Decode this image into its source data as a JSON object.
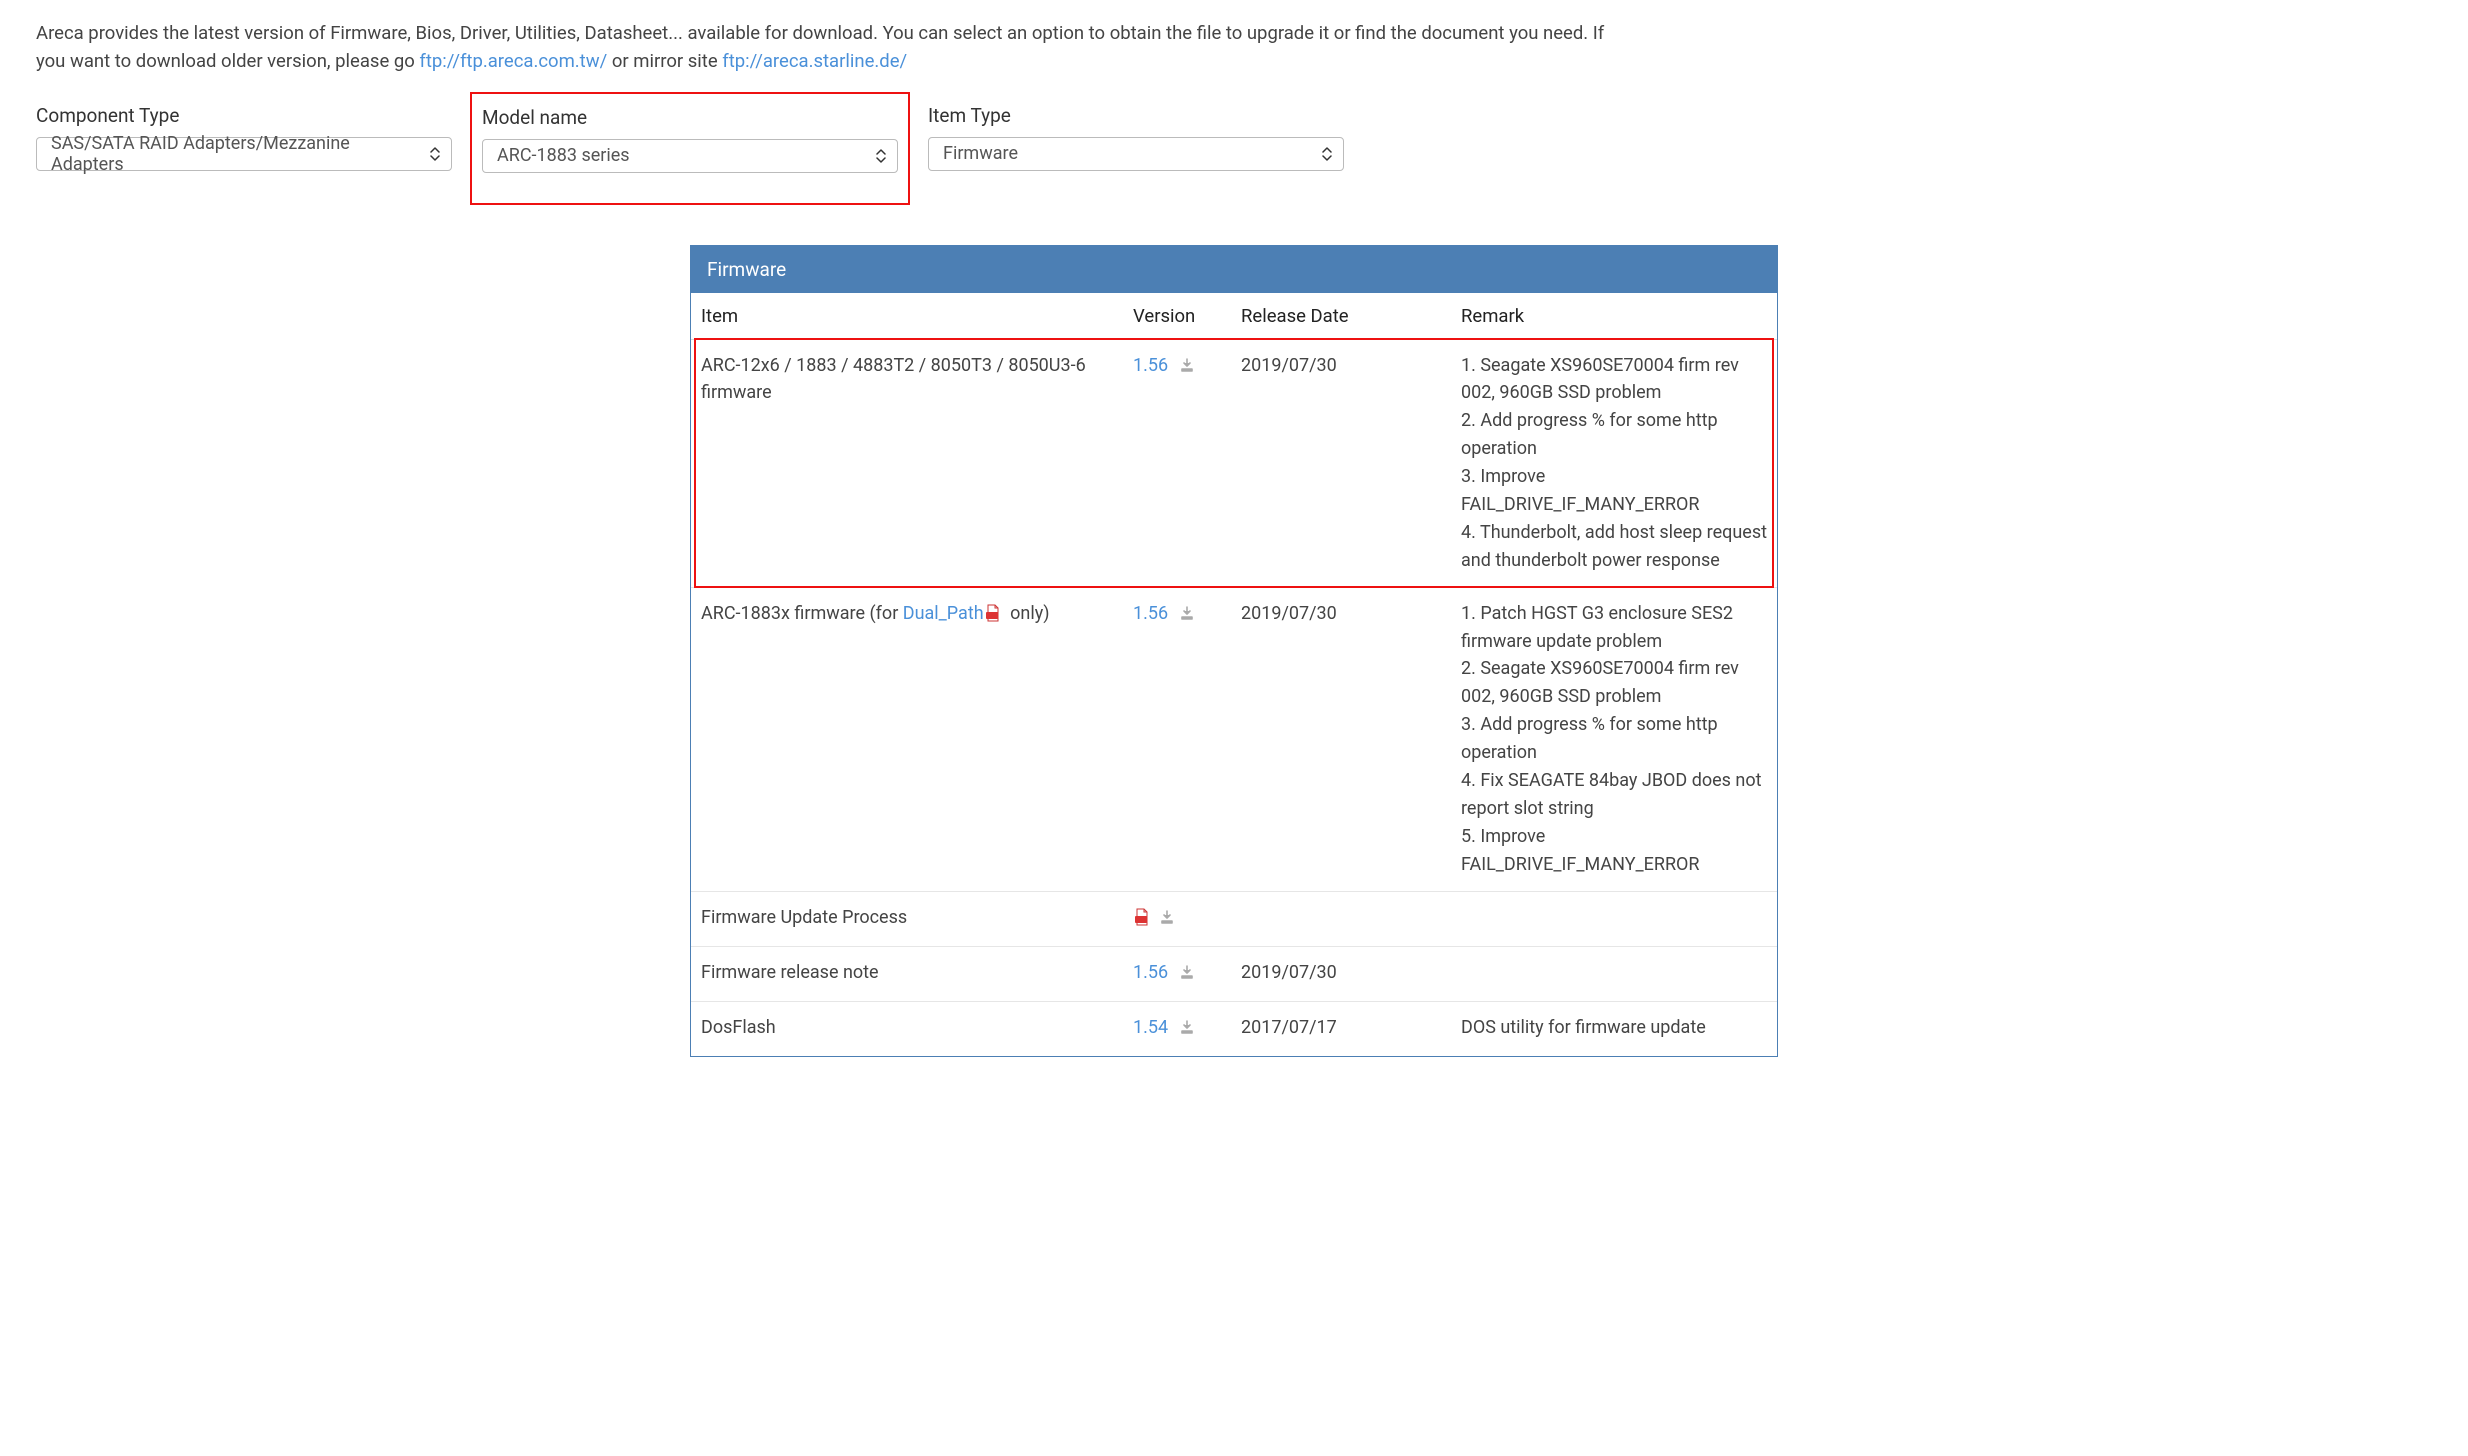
{
  "intro": {
    "text_before": "Areca provides the latest version of Firmware, Bios, Driver, Utilities, Datasheet... available for download. You can select an option to obtain the file to upgrade it or find the document you need. If you want to download older version, please go ",
    "link1_text": "ftp://ftp.areca.com.tw/",
    "text_mid": " or mirror site ",
    "link2_text": "ftp://areca.starline.de/"
  },
  "filters": {
    "component_type": {
      "label": "Component Type",
      "value": "SAS/SATA RAID Adapters/Mezzanine Adapters"
    },
    "model_name": {
      "label": "Model name",
      "value": "ARC-1883 series"
    },
    "item_type": {
      "label": "Item Type",
      "value": "Firmware"
    }
  },
  "table": {
    "title": "Firmware",
    "headers": {
      "item": "Item",
      "version": "Version",
      "date": "Release Date",
      "remark": "Remark"
    },
    "rows": [
      {
        "item": "ARC-12x6 / 1883 / 4883T2 / 8050T3 / 8050U3-6 firmware",
        "version": "1.56",
        "date": "2019/07/30",
        "remark": "1. Seagate XS960SE70004 firm rev 002, 960GB SSD problem\n2. Add progress % for some http operation\n3. Improve FAIL_DRIVE_IF_MANY_ERROR\n4. Thunderbolt, add host sleep request and thunderbolt power response"
      },
      {
        "item_prefix": "ARC-1883x firmware (for ",
        "item_link": "Dual_Path",
        "item_suffix": " only)",
        "version": "1.56",
        "date": "2019/07/30",
        "remark": "1. Patch HGST G3 enclosure SES2 firmware update problem\n2. Seagate XS960SE70004 firm rev 002, 960GB SSD problem\n3. Add progress % for some http operation\n4. Fix SEAGATE 84bay JBOD does not report slot string\n5. Improve FAIL_DRIVE_IF_MANY_ERROR"
      },
      {
        "item": "Firmware Update Process",
        "version": "",
        "date": "",
        "remark": ""
      },
      {
        "item": "Firmware release note",
        "version": "1.56",
        "date": "2019/07/30",
        "remark": ""
      },
      {
        "item": "DosFlash",
        "version": "1.54",
        "date": "2017/07/17",
        "remark": "DOS utility for firmware update"
      }
    ]
  }
}
